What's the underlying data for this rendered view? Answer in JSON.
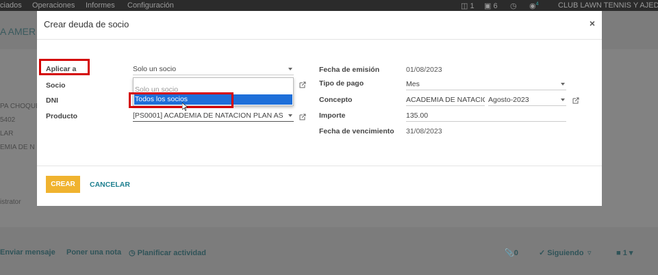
{
  "navbar": {
    "menu": [
      "ciados",
      "Operaciones",
      "Informes",
      "Configuración"
    ],
    "chat_count": "1",
    "activity_count": "6",
    "messages_badge": "4",
    "company": "CLUB LAWN TENNIS Y AJEDR"
  },
  "background": {
    "title": "A AMER",
    "left_texts": [
      "PA CHOQUE",
      "5402",
      "LAR",
      "EMIA DE N",
      "istrator"
    ],
    "chatter": {
      "send_message": "Enviar mensaje",
      "log_note": "Poner una nota",
      "schedule_activity": "Planificar actividad",
      "attachments_count": "0",
      "following": "Siguiendo",
      "followers_count": "1"
    }
  },
  "modal": {
    "title": "Crear deuda de socio",
    "close": "×",
    "left": {
      "aplicar_label": "Aplicar a",
      "aplicar_value": "Solo un socio",
      "socio_label": "Socio",
      "dni_label": "DNI",
      "producto_label": "Producto",
      "producto_value": "[PS0001] ACADEMIA DE NATACION PLAN AS"
    },
    "dropdown": {
      "options": [
        "Solo un socio",
        "Todos los socios"
      ],
      "selected": "Todos los socios"
    },
    "right": {
      "fecha_emision_label": "Fecha de emisión",
      "fecha_emision_value": "01/08/2023",
      "tipo_pago_label": "Tipo de pago",
      "tipo_pago_value": "Mes",
      "concepto_label": "Concepto",
      "concepto_value": "ACADEMIA DE NATACIO",
      "concepto_period": "Agosto-2023",
      "importe_label": "Importe",
      "importe_value": "135.00",
      "fecha_venc_label": "Fecha de vencimiento",
      "fecha_venc_value": "31/08/2023"
    },
    "footer": {
      "create": "CREAR",
      "cancel": "CANCELAR"
    }
  },
  "colors": {
    "accent_button": "#f0b32f",
    "link": "#1d7f8f",
    "highlight_box": "#d40000",
    "dropdown_selected": "#1e6fd9"
  }
}
